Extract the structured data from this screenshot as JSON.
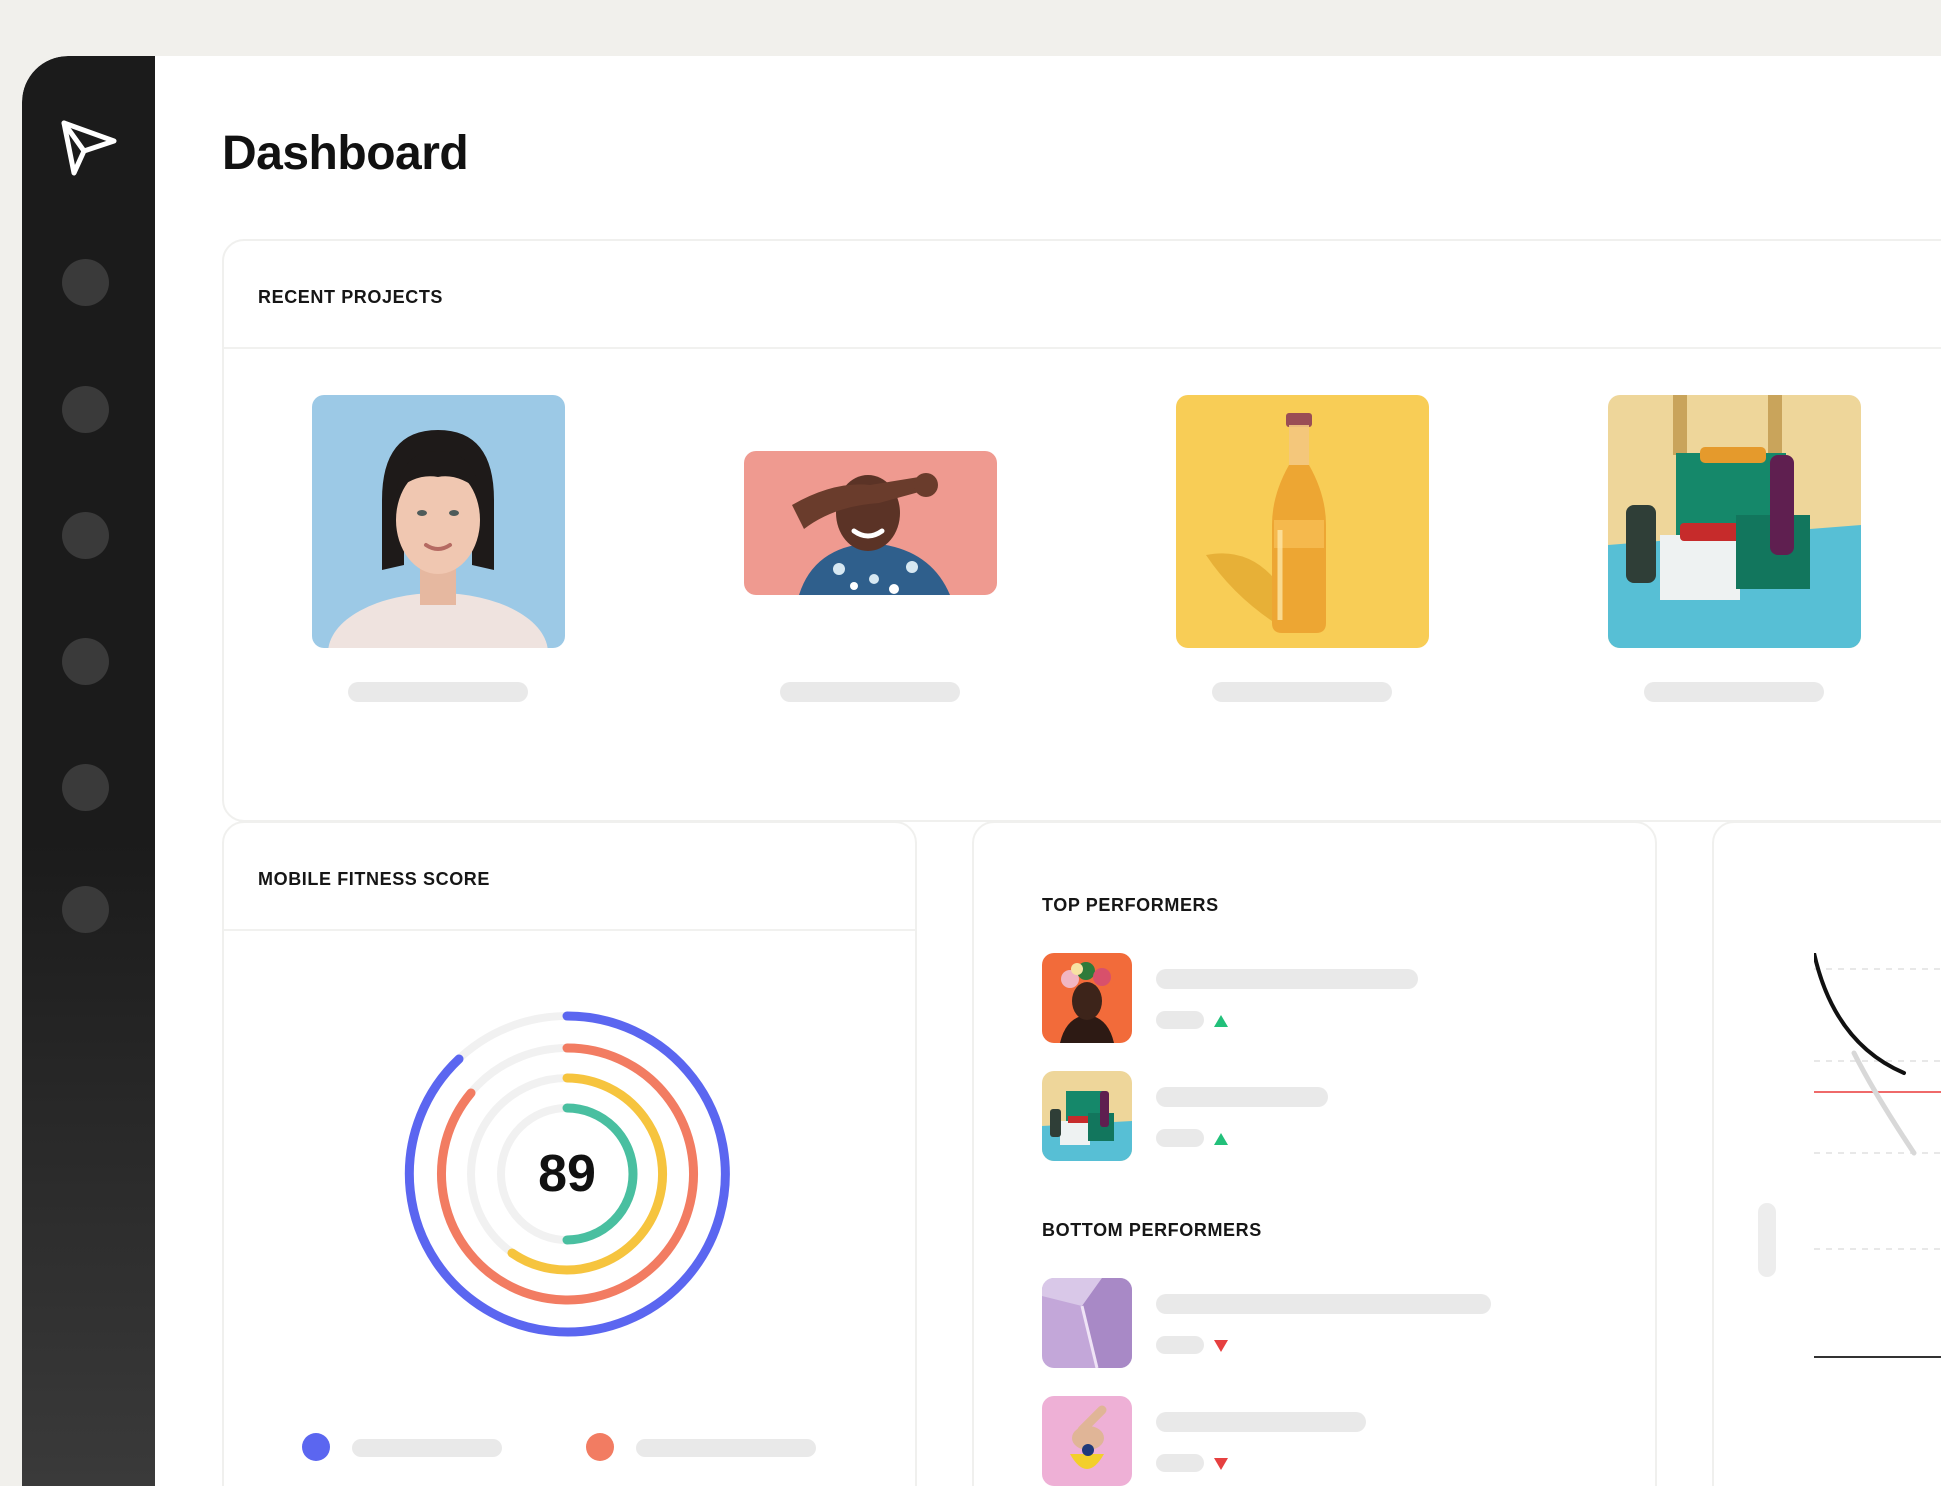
{
  "page": {
    "title": "Dashboard"
  },
  "colors": {
    "sidebar": "#1b1b1b",
    "ring_blue": "#5b66f0",
    "ring_coral": "#f27c62",
    "ring_yellow": "#f6c43e",
    "ring_teal": "#49bfa0",
    "up": "#22c07a",
    "down": "#e64040"
  },
  "sidebar": {
    "logo_icon": "paper-plane-icon",
    "items": [
      "nav-item-1",
      "nav-item-2",
      "nav-item-3",
      "nav-item-4",
      "nav-item-5",
      "nav-item-6"
    ]
  },
  "recent_projects": {
    "title": "RECENT PROJECTS",
    "items": [
      {
        "thumbnail": "portrait-woman"
      },
      {
        "thumbnail": "man-pink-background"
      },
      {
        "thumbnail": "bottle-yellow"
      },
      {
        "thumbnail": "product-blocks"
      }
    ]
  },
  "mobile_fitness": {
    "title": "MOBILE FITNESS SCORE",
    "score": "89",
    "legend_colors": [
      "#5b66f0",
      "#f27c62",
      "#f6c43e",
      "#49bfa0"
    ]
  },
  "performers": {
    "top_title": "TOP PERFORMERS",
    "bottom_title": "BOTTOM PERFORMERS",
    "top": [
      {
        "thumbnail": "flower-woman-orange",
        "trend": "up"
      },
      {
        "thumbnail": "product-blocks",
        "trend": "up"
      }
    ],
    "bottom": [
      {
        "thumbnail": "purple-abstract",
        "trend": "down"
      },
      {
        "thumbnail": "pink-hand-yellow",
        "trend": "down"
      }
    ]
  }
}
